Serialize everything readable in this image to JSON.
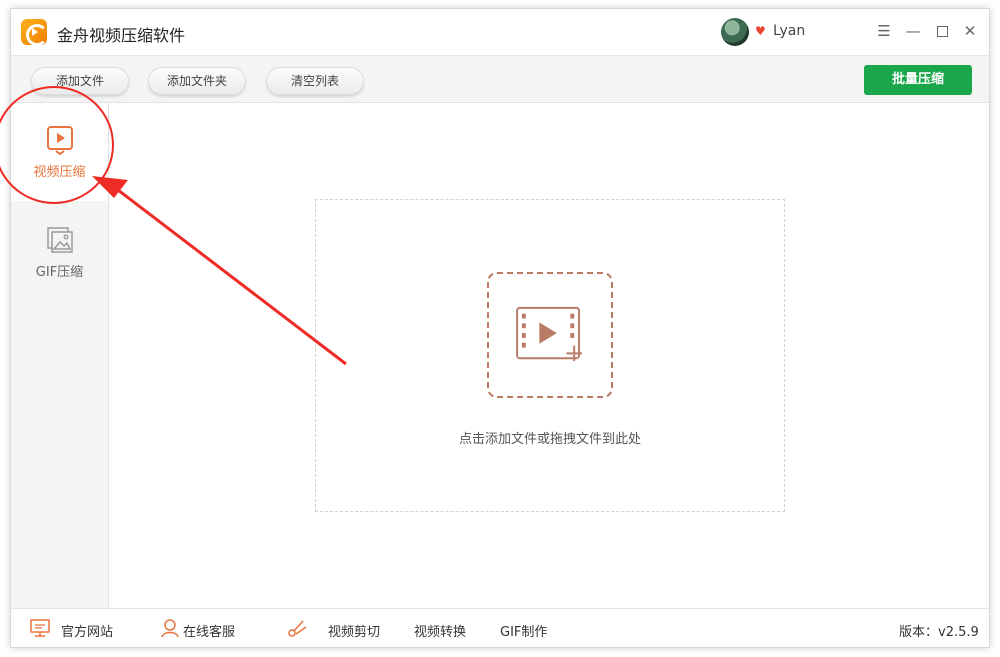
{
  "app": {
    "title": "金舟视频压缩软件",
    "user_name": "Lyan"
  },
  "toolbar": {
    "add_file": "添加文件",
    "add_folder": "添加文件夹",
    "clear_list": "清空列表",
    "batch_compress": "批量压缩"
  },
  "sidebar": {
    "items": [
      {
        "label": "视频压缩",
        "icon": "video-compress-icon",
        "active": true
      },
      {
        "label": "GIF压缩",
        "icon": "gif-image-icon",
        "active": false
      }
    ]
  },
  "main": {
    "drop_hint": "点击添加文件或拖拽文件到此处"
  },
  "statusbar": {
    "official_site": "官方网站",
    "online_service": "在线客服",
    "video_cut": "视频剪切",
    "video_convert": "视频转换",
    "gif_make": "GIF制作",
    "version": "版本：v2.5.9"
  },
  "colors": {
    "accent_green": "#1aa64a",
    "active_orange": "#e8743c",
    "annotation_red": "#ee2b24",
    "drop_brown": "#b97a66"
  }
}
